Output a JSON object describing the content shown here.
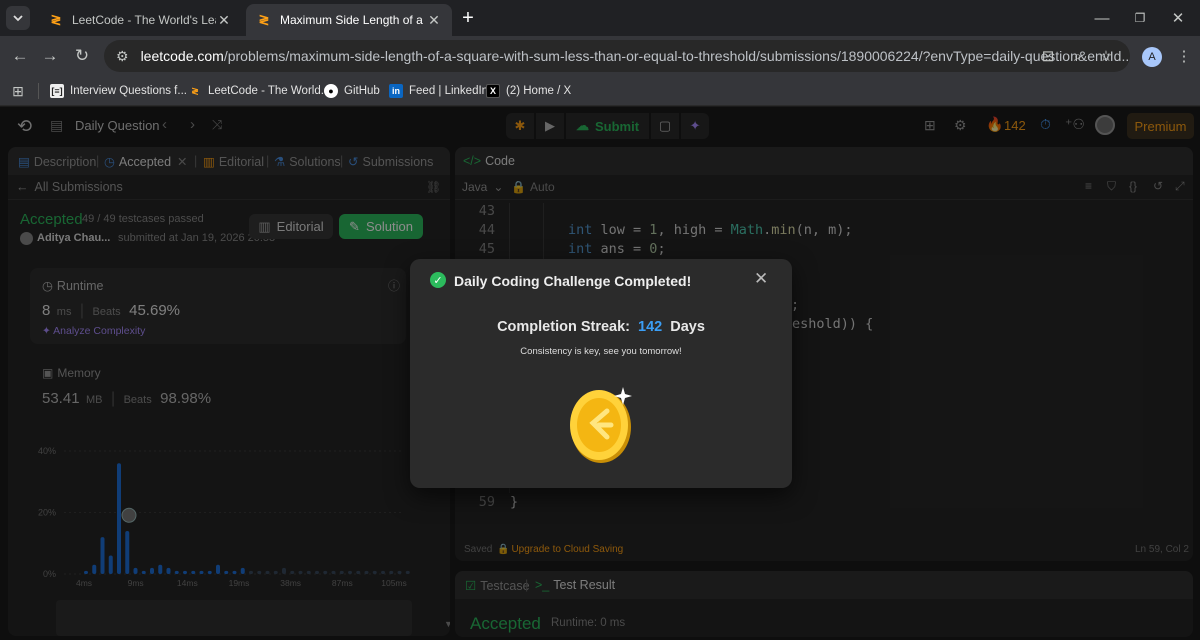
{
  "browser": {
    "tabs": [
      {
        "label": "LeetCode - The World's Leading P",
        "active": false
      },
      {
        "label": "Maximum Side Length of a Square",
        "active": true
      }
    ],
    "url_host": "leetcode.com",
    "url_path": "/problems/maximum-side-length-of-a-square-with-sum-less-than-or-equal-to-threshold/submissions/1890006224/?envType=daily-question&envId...",
    "profile_initial": "A",
    "bookmarks": [
      {
        "label": "Interview Questions f...",
        "icon": "dsa-icon"
      },
      {
        "label": "LeetCode - The World...",
        "icon": "leetcode-icon"
      },
      {
        "label": "GitHub",
        "icon": "github-icon"
      },
      {
        "label": "Feed | LinkedIn",
        "icon": "linkedin-icon"
      },
      {
        "label": "(2) Home / X",
        "icon": "x-icon"
      }
    ]
  },
  "topbar": {
    "title": "Daily Question",
    "submit_label": "Submit",
    "streak_count": "142",
    "premium_label": "Premium"
  },
  "left": {
    "tabs": [
      "Description",
      "Accepted",
      "Editorial",
      "Solutions",
      "Submissions"
    ],
    "all_submissions": "All Submissions",
    "status": "Accepted",
    "testcases": "49 / 49 testcases passed",
    "user": "Aditya Chau...",
    "submitted_at": "submitted at Jan 19, 2026 20:58",
    "editorial_btn": "Editorial",
    "solution_btn": "Solution",
    "runtime": {
      "label": "Runtime",
      "value": "8",
      "unit": "ms",
      "beats_label": "Beats",
      "beats": "45.69%",
      "analyze": "Analyze Complexity"
    },
    "memory": {
      "label": "Memory",
      "value": "53.41",
      "unit": "MB",
      "beats_label": "Beats",
      "beats": "98.98%"
    }
  },
  "chart_data": {
    "type": "bar",
    "y_ticks": [
      "40%",
      "20%",
      "0%"
    ],
    "x_ticks": [
      "4ms",
      "9ms",
      "14ms",
      "19ms",
      "38ms",
      "87ms",
      "105ms"
    ],
    "values": [
      1,
      3,
      12,
      6,
      36,
      14,
      2,
      1,
      2,
      3,
      2,
      1,
      1,
      1,
      1,
      1,
      3,
      1,
      1,
      2,
      1,
      1,
      1,
      1,
      2,
      1,
      1,
      1,
      1,
      1,
      1,
      1,
      1,
      1,
      1,
      1,
      1,
      1,
      1,
      1
    ],
    "highlight_index": 4,
    "accent": "#1e6fd9"
  },
  "code_panel": {
    "title": "Code",
    "language": "Java",
    "mode": "Auto",
    "lines": [
      {
        "n": "43",
        "parts": []
      },
      {
        "n": "44",
        "parts": [
          [
            "kw",
            "int"
          ],
          [
            "tx",
            " low = "
          ],
          [
            "num",
            "1"
          ],
          [
            "tx",
            ", high = "
          ],
          [
            "cls",
            "Math"
          ],
          [
            "tx",
            "."
          ],
          [
            "fn",
            "min"
          ],
          [
            "tx",
            "(n, m);"
          ]
        ]
      },
      {
        "n": "45",
        "parts": [
          [
            "kw",
            "int"
          ],
          [
            "tx",
            " ans = "
          ],
          [
            "num",
            "0"
          ],
          [
            "tx",
            ";"
          ]
        ]
      }
    ],
    "partial_1": ";",
    "partial_2": "eshold)) {",
    "brace_line": "}",
    "line59": {
      "n": "59",
      "text": "}"
    },
    "saved": "Saved",
    "upgrade": "Upgrade to Cloud Saving",
    "cursor": "Ln 59, Col 2"
  },
  "bottom": {
    "tab_testcase": "Testcase",
    "tab_result": "Test Result",
    "status": "Accepted",
    "runtime": "Runtime: 0 ms"
  },
  "modal": {
    "title": "Daily Coding Challenge Completed!",
    "streak_label": "Completion Streak:",
    "streak_value": "142",
    "streak_unit": "Days",
    "subtitle": "Consistency is key, see you tomorrow!"
  }
}
